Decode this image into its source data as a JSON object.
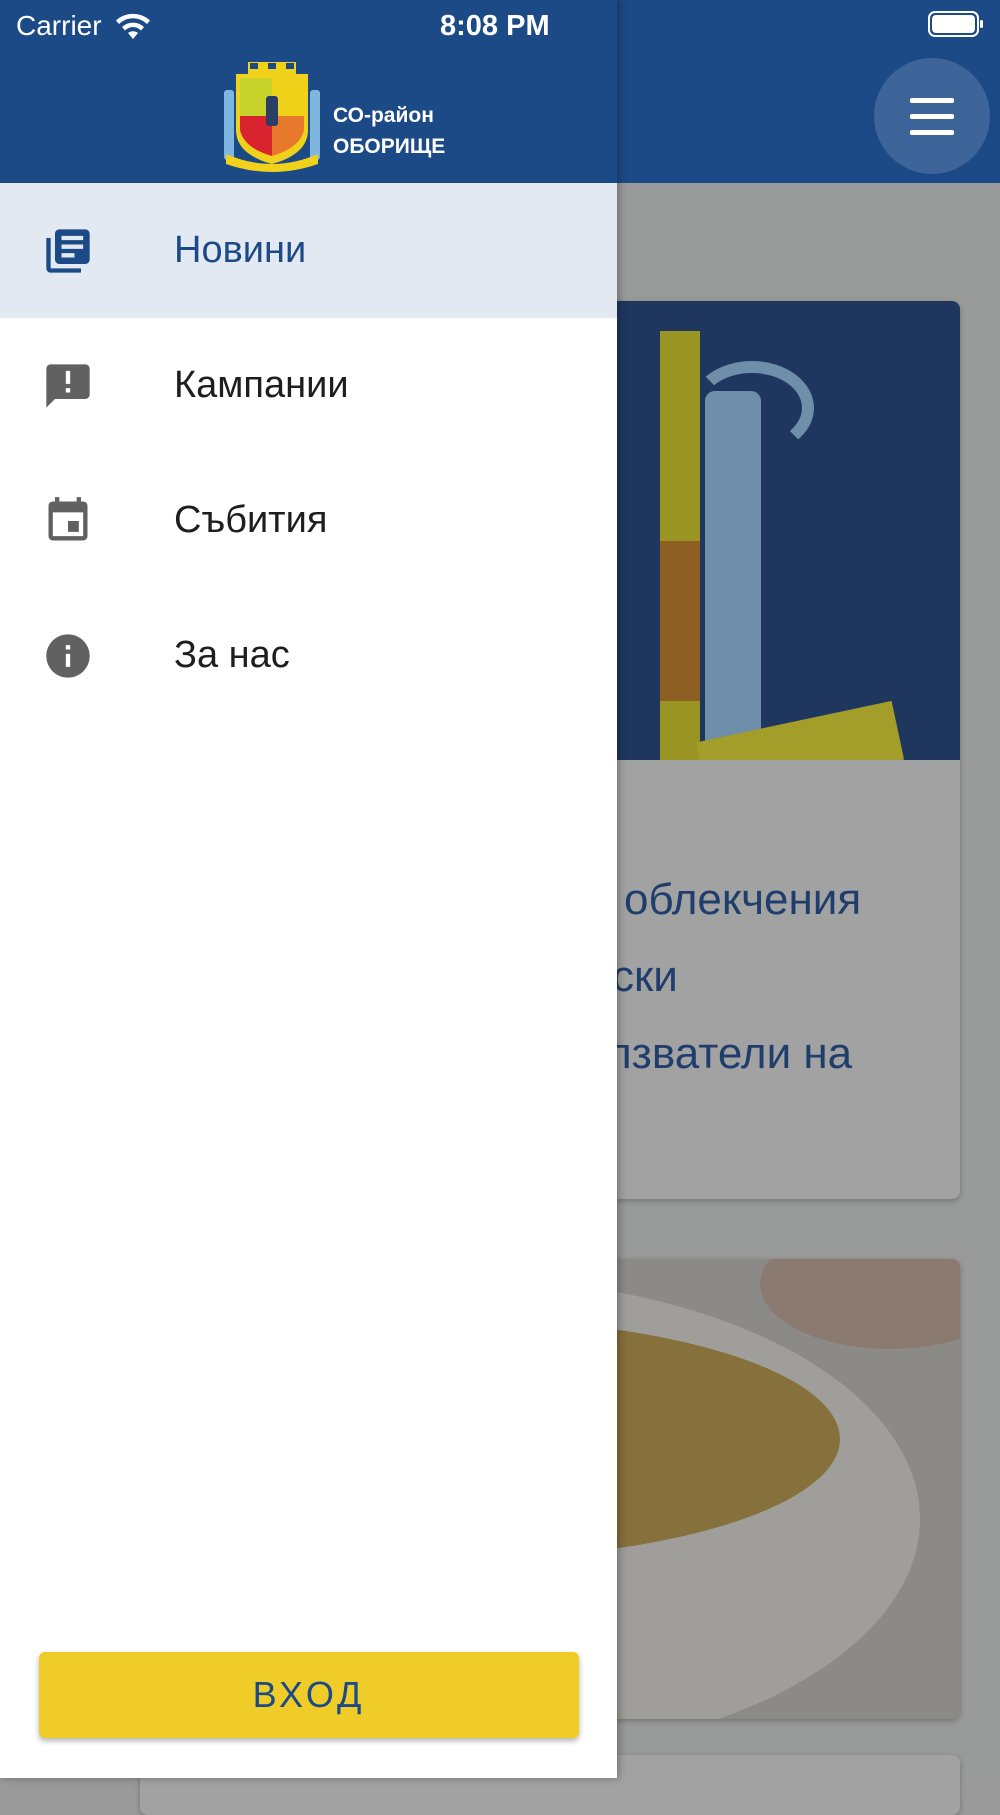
{
  "status_bar": {
    "carrier": "Carrier",
    "time": "8:08 PM"
  },
  "drawer": {
    "logo_line1": "СО-район",
    "logo_line2": "ОБОРИЩЕ",
    "items": [
      {
        "label": "Новини",
        "icon": "news-icon",
        "active": true
      },
      {
        "label": "Кампании",
        "icon": "announcement-icon",
        "active": false
      },
      {
        "label": "Събития",
        "icon": "calendar-icon",
        "active": false
      },
      {
        "label": "За нас",
        "icon": "info-icon",
        "active": false
      }
    ],
    "login_label": "ВХОД"
  },
  "background": {
    "card1_text_lines": [
      "облекчения",
      "ски",
      "лзватели на"
    ]
  },
  "colors": {
    "primary": "#1c4a86",
    "active_item_bg": "#e3e9f3",
    "button_yellow": "#f0cc28",
    "icon_gray": "#616161"
  }
}
